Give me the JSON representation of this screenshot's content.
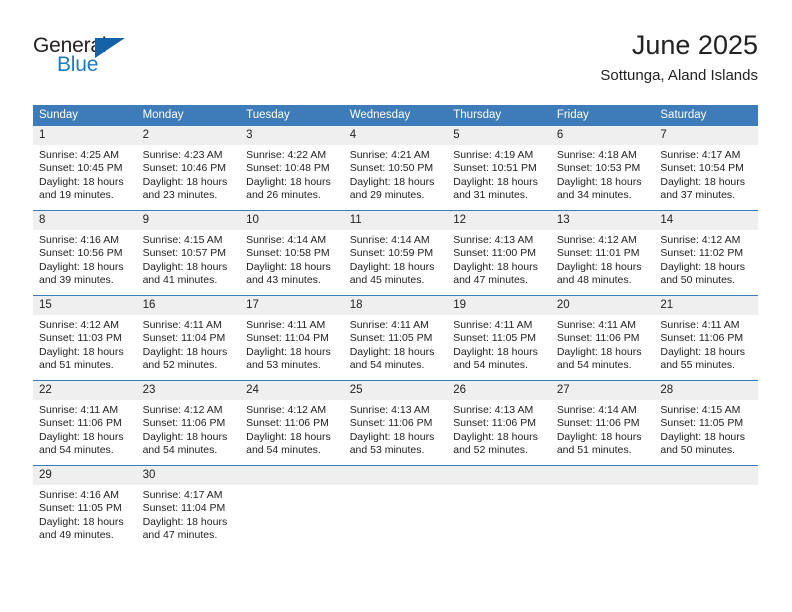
{
  "brand": {
    "name_top": "General",
    "name_bottom": "Blue",
    "triangle_icon": "triangle-icon",
    "accent_color": "#1a7dc4"
  },
  "header": {
    "title": "June 2025",
    "subtitle": "Sottunga, Aland Islands"
  },
  "theme": {
    "header_blue": "#3d7cb8",
    "daynum_gray": "#efeff0",
    "text": "#222222"
  },
  "calendar": {
    "weekday_headers": [
      "Sunday",
      "Monday",
      "Tuesday",
      "Wednesday",
      "Thursday",
      "Friday",
      "Saturday"
    ],
    "weeks": [
      [
        {
          "day": "1",
          "sunrise": "Sunrise: 4:25 AM",
          "sunset": "Sunset: 10:45 PM",
          "daylight1": "Daylight: 18 hours",
          "daylight2": "and 19 minutes."
        },
        {
          "day": "2",
          "sunrise": "Sunrise: 4:23 AM",
          "sunset": "Sunset: 10:46 PM",
          "daylight1": "Daylight: 18 hours",
          "daylight2": "and 23 minutes."
        },
        {
          "day": "3",
          "sunrise": "Sunrise: 4:22 AM",
          "sunset": "Sunset: 10:48 PM",
          "daylight1": "Daylight: 18 hours",
          "daylight2": "and 26 minutes."
        },
        {
          "day": "4",
          "sunrise": "Sunrise: 4:21 AM",
          "sunset": "Sunset: 10:50 PM",
          "daylight1": "Daylight: 18 hours",
          "daylight2": "and 29 minutes."
        },
        {
          "day": "5",
          "sunrise": "Sunrise: 4:19 AM",
          "sunset": "Sunset: 10:51 PM",
          "daylight1": "Daylight: 18 hours",
          "daylight2": "and 31 minutes."
        },
        {
          "day": "6",
          "sunrise": "Sunrise: 4:18 AM",
          "sunset": "Sunset: 10:53 PM",
          "daylight1": "Daylight: 18 hours",
          "daylight2": "and 34 minutes."
        },
        {
          "day": "7",
          "sunrise": "Sunrise: 4:17 AM",
          "sunset": "Sunset: 10:54 PM",
          "daylight1": "Daylight: 18 hours",
          "daylight2": "and 37 minutes."
        }
      ],
      [
        {
          "day": "8",
          "sunrise": "Sunrise: 4:16 AM",
          "sunset": "Sunset: 10:56 PM",
          "daylight1": "Daylight: 18 hours",
          "daylight2": "and 39 minutes."
        },
        {
          "day": "9",
          "sunrise": "Sunrise: 4:15 AM",
          "sunset": "Sunset: 10:57 PM",
          "daylight1": "Daylight: 18 hours",
          "daylight2": "and 41 minutes."
        },
        {
          "day": "10",
          "sunrise": "Sunrise: 4:14 AM",
          "sunset": "Sunset: 10:58 PM",
          "daylight1": "Daylight: 18 hours",
          "daylight2": "and 43 minutes."
        },
        {
          "day": "11",
          "sunrise": "Sunrise: 4:14 AM",
          "sunset": "Sunset: 10:59 PM",
          "daylight1": "Daylight: 18 hours",
          "daylight2": "and 45 minutes."
        },
        {
          "day": "12",
          "sunrise": "Sunrise: 4:13 AM",
          "sunset": "Sunset: 11:00 PM",
          "daylight1": "Daylight: 18 hours",
          "daylight2": "and 47 minutes."
        },
        {
          "day": "13",
          "sunrise": "Sunrise: 4:12 AM",
          "sunset": "Sunset: 11:01 PM",
          "daylight1": "Daylight: 18 hours",
          "daylight2": "and 48 minutes."
        },
        {
          "day": "14",
          "sunrise": "Sunrise: 4:12 AM",
          "sunset": "Sunset: 11:02 PM",
          "daylight1": "Daylight: 18 hours",
          "daylight2": "and 50 minutes."
        }
      ],
      [
        {
          "day": "15",
          "sunrise": "Sunrise: 4:12 AM",
          "sunset": "Sunset: 11:03 PM",
          "daylight1": "Daylight: 18 hours",
          "daylight2": "and 51 minutes."
        },
        {
          "day": "16",
          "sunrise": "Sunrise: 4:11 AM",
          "sunset": "Sunset: 11:04 PM",
          "daylight1": "Daylight: 18 hours",
          "daylight2": "and 52 minutes."
        },
        {
          "day": "17",
          "sunrise": "Sunrise: 4:11 AM",
          "sunset": "Sunset: 11:04 PM",
          "daylight1": "Daylight: 18 hours",
          "daylight2": "and 53 minutes."
        },
        {
          "day": "18",
          "sunrise": "Sunrise: 4:11 AM",
          "sunset": "Sunset: 11:05 PM",
          "daylight1": "Daylight: 18 hours",
          "daylight2": "and 54 minutes."
        },
        {
          "day": "19",
          "sunrise": "Sunrise: 4:11 AM",
          "sunset": "Sunset: 11:05 PM",
          "daylight1": "Daylight: 18 hours",
          "daylight2": "and 54 minutes."
        },
        {
          "day": "20",
          "sunrise": "Sunrise: 4:11 AM",
          "sunset": "Sunset: 11:06 PM",
          "daylight1": "Daylight: 18 hours",
          "daylight2": "and 54 minutes."
        },
        {
          "day": "21",
          "sunrise": "Sunrise: 4:11 AM",
          "sunset": "Sunset: 11:06 PM",
          "daylight1": "Daylight: 18 hours",
          "daylight2": "and 55 minutes."
        }
      ],
      [
        {
          "day": "22",
          "sunrise": "Sunrise: 4:11 AM",
          "sunset": "Sunset: 11:06 PM",
          "daylight1": "Daylight: 18 hours",
          "daylight2": "and 54 minutes."
        },
        {
          "day": "23",
          "sunrise": "Sunrise: 4:12 AM",
          "sunset": "Sunset: 11:06 PM",
          "daylight1": "Daylight: 18 hours",
          "daylight2": "and 54 minutes."
        },
        {
          "day": "24",
          "sunrise": "Sunrise: 4:12 AM",
          "sunset": "Sunset: 11:06 PM",
          "daylight1": "Daylight: 18 hours",
          "daylight2": "and 54 minutes."
        },
        {
          "day": "25",
          "sunrise": "Sunrise: 4:13 AM",
          "sunset": "Sunset: 11:06 PM",
          "daylight1": "Daylight: 18 hours",
          "daylight2": "and 53 minutes."
        },
        {
          "day": "26",
          "sunrise": "Sunrise: 4:13 AM",
          "sunset": "Sunset: 11:06 PM",
          "daylight1": "Daylight: 18 hours",
          "daylight2": "and 52 minutes."
        },
        {
          "day": "27",
          "sunrise": "Sunrise: 4:14 AM",
          "sunset": "Sunset: 11:06 PM",
          "daylight1": "Daylight: 18 hours",
          "daylight2": "and 51 minutes."
        },
        {
          "day": "28",
          "sunrise": "Sunrise: 4:15 AM",
          "sunset": "Sunset: 11:05 PM",
          "daylight1": "Daylight: 18 hours",
          "daylight2": "and 50 minutes."
        }
      ],
      [
        {
          "day": "29",
          "sunrise": "Sunrise: 4:16 AM",
          "sunset": "Sunset: 11:05 PM",
          "daylight1": "Daylight: 18 hours",
          "daylight2": "and 49 minutes."
        },
        {
          "day": "30",
          "sunrise": "Sunrise: 4:17 AM",
          "sunset": "Sunset: 11:04 PM",
          "daylight1": "Daylight: 18 hours",
          "daylight2": "and 47 minutes."
        },
        {
          "day": "",
          "sunrise": "",
          "sunset": "",
          "daylight1": "",
          "daylight2": ""
        },
        {
          "day": "",
          "sunrise": "",
          "sunset": "",
          "daylight1": "",
          "daylight2": ""
        },
        {
          "day": "",
          "sunrise": "",
          "sunset": "",
          "daylight1": "",
          "daylight2": ""
        },
        {
          "day": "",
          "sunrise": "",
          "sunset": "",
          "daylight1": "",
          "daylight2": ""
        },
        {
          "day": "",
          "sunrise": "",
          "sunset": "",
          "daylight1": "",
          "daylight2": ""
        }
      ]
    ]
  }
}
